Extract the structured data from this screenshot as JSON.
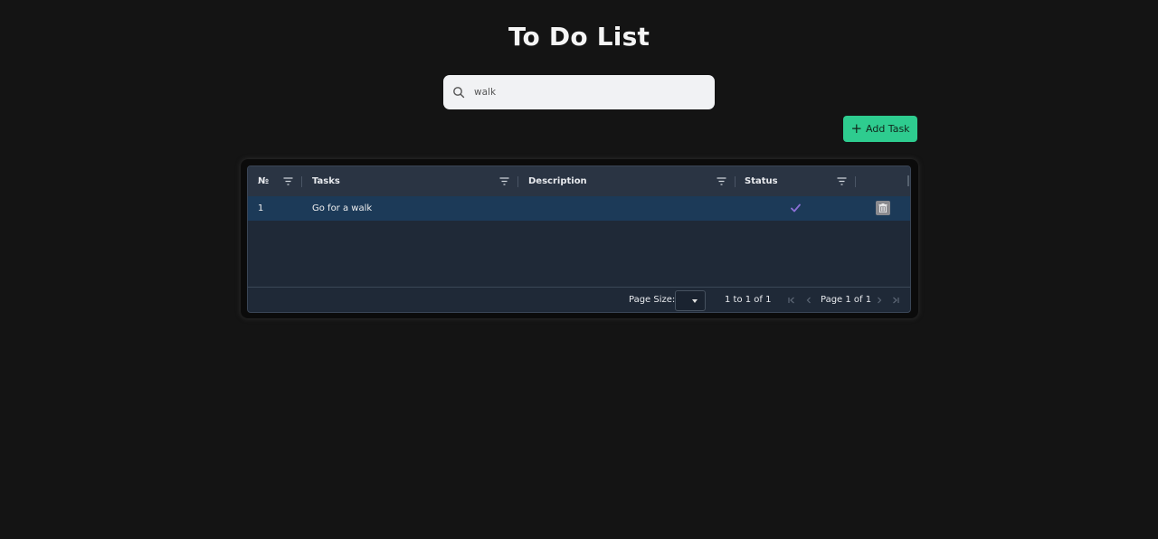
{
  "title": "To Do List",
  "search": {
    "value": "walk",
    "placeholder": ""
  },
  "add_button": {
    "label": "Add Task"
  },
  "grid": {
    "columns": [
      "№",
      "Tasks",
      "Description",
      "Status"
    ],
    "rows": [
      {
        "number": "1",
        "task": "Go for a walk",
        "description": "",
        "status": "done"
      }
    ],
    "footer": {
      "page_size_label": "Page Size:",
      "page_size_value": "",
      "range_text": "1 to 1 of 1",
      "page_text": "Page 1 of 1"
    }
  },
  "colors": {
    "background": "#141414",
    "accent": "#2ecc8f",
    "row_selected": "#1c3a58",
    "check": "#8b6fd6"
  },
  "icons": [
    "search-icon",
    "plus-icon",
    "filter-icon",
    "check-icon",
    "trash-icon",
    "first-page-icon",
    "prev-page-icon",
    "next-page-icon",
    "last-page-icon"
  ]
}
